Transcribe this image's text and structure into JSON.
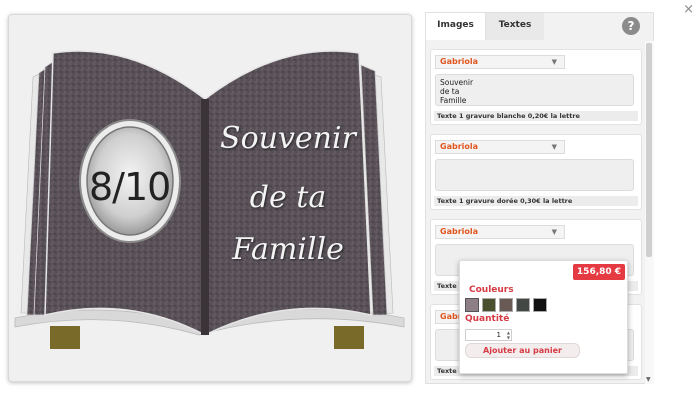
{
  "window": {
    "close_glyph": "×"
  },
  "preview": {
    "plaque_number": "8/10",
    "inscription_lines": [
      "Souvenir",
      "de ta",
      "Famille"
    ]
  },
  "panel": {
    "tabs": [
      "Images",
      "Textes"
    ],
    "help_glyph": "?",
    "text_blocks": [
      {
        "font": "Gabriola",
        "value": "Souvenir\nde ta\nFamille",
        "engraving": "Texte 1 gravure blanche 0,20€ la lettre"
      },
      {
        "font": "Gabriola",
        "value": "",
        "engraving": "Texte 1 gravure dorée 0,30€ la lettre"
      },
      {
        "font": "Gabriola",
        "value": "",
        "engraving": "Texte 1"
      },
      {
        "font": "Gabriola",
        "value": "",
        "engraving": "Texte 2"
      }
    ]
  },
  "popup": {
    "price": "156,80 €",
    "colors_label": "Couleurs",
    "swatches": [
      "#8e7f86",
      "#4a4f2e",
      "#6a5a56",
      "#444844",
      "#111111"
    ],
    "quantity_label": "Quantité",
    "quantity_value": "1",
    "cart_button": "Ajouter au panier"
  },
  "icons": {
    "help": "help-icon",
    "caret": "chevron-down-icon",
    "close": "close-icon",
    "spinner": "spinner-arrows-icon"
  }
}
